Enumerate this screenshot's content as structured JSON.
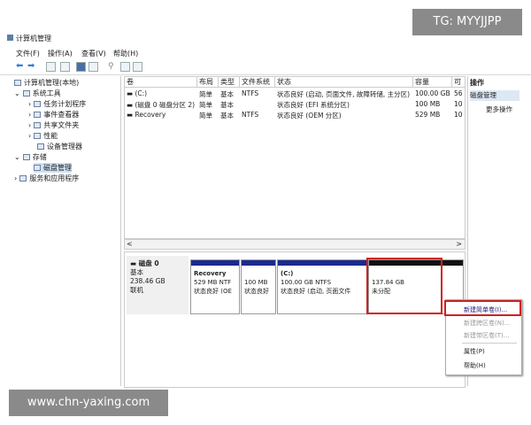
{
  "watermark_top": "TG: MYYJJPP",
  "watermark_bottom": "www.chn-yaxing.com",
  "window_title": "计算机管理",
  "menu": [
    "文件(F)",
    "操作(A)",
    "查看(V)",
    "帮助(H)"
  ],
  "tree": {
    "root": "计算机管理(本地)",
    "system_tools": "系统工具",
    "task_scheduler": "任务计划程序",
    "event_viewer": "事件查看器",
    "shared_folders": "共享文件夹",
    "performance": "性能",
    "device_manager": "设备管理器",
    "storage": "存储",
    "disk_management": "磁盘管理",
    "services_apps": "服务和应用程序"
  },
  "table": {
    "headers": [
      "卷",
      "布局",
      "类型",
      "文件系统",
      "状态",
      "容量",
      "可"
    ],
    "rows": [
      [
        "(C:)",
        "简单",
        "基本",
        "NTFS",
        "状态良好 (启动, 页面文件, 故障转储, 主分区)",
        "100.00 GB",
        "56"
      ],
      [
        "(磁盘 0 磁盘分区 2)",
        "简单",
        "基本",
        "",
        "状态良好 (EFI 系统分区)",
        "100 MB",
        "10"
      ],
      [
        "Recovery",
        "简单",
        "基本",
        "NTFS",
        "状态良好 (OEM 分区)",
        "529 MB",
        "10"
      ]
    ]
  },
  "scroll": {
    "left": "<",
    "right": ">"
  },
  "disk": {
    "name": "磁盘 0",
    "type": "基本",
    "size": "238.46 GB",
    "status": "联机"
  },
  "partitions": [
    {
      "name": "Recovery",
      "size": "529 MB NTF",
      "status": "状态良好 (OE"
    },
    {
      "name": "",
      "size": "100 MB",
      "status": "状态良好"
    },
    {
      "name": "(C:)",
      "size": "100.00 GB NTFS",
      "status": "状态良好 (启动, 页面文件"
    },
    {
      "name": "",
      "size": "137.84 GB",
      "status": "未分配"
    }
  ],
  "actions": {
    "header": "操作",
    "section": "磁盘管理",
    "more": "更多操作"
  },
  "context_menu": [
    {
      "label": "新建简单卷(I)...",
      "enabled": true
    },
    {
      "label": "新建跨区卷(N)...",
      "enabled": false
    },
    {
      "label": "新建带区卷(T)...",
      "enabled": false
    },
    {
      "label": "属性(P)",
      "enabled": true
    },
    {
      "label": "帮助(H)",
      "enabled": true
    }
  ],
  "colors": {
    "partition_bar": "#1b2a8f",
    "highlight": "#d02020",
    "selection": "#cfe2f7"
  }
}
